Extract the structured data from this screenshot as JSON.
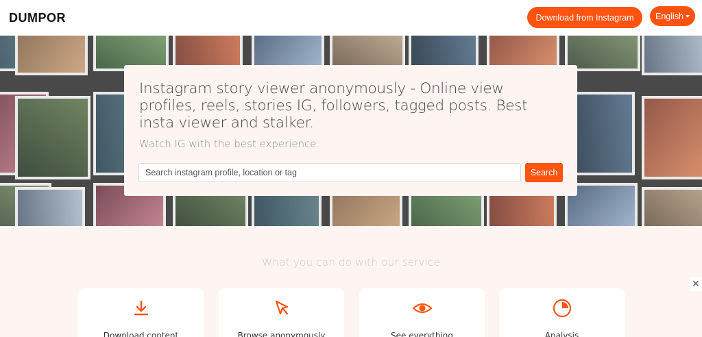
{
  "header": {
    "logo": "DUMPOR",
    "download_label": "Download from Instagram",
    "language_label": "English"
  },
  "hero": {
    "title": "Instagram story viewer anonymously - Online view profiles, reels, stories IG, followers, tagged posts. Best insta viewer and stalker.",
    "subtitle": "Watch IG with the best experience.",
    "search_placeholder": "Search instagram profile, location or tag",
    "search_button": "Search"
  },
  "services": {
    "title": "What you can do with our service",
    "cards": [
      {
        "icon": "download-icon",
        "label": "Download content"
      },
      {
        "icon": "cursor-icon",
        "label": "Browse anonymously"
      },
      {
        "icon": "eye-icon",
        "label": "See everything"
      },
      {
        "icon": "pie-chart-icon",
        "label": "Analysis"
      }
    ]
  },
  "colors": {
    "accent": "#ff5310",
    "section_bg": "#fef5f2"
  }
}
